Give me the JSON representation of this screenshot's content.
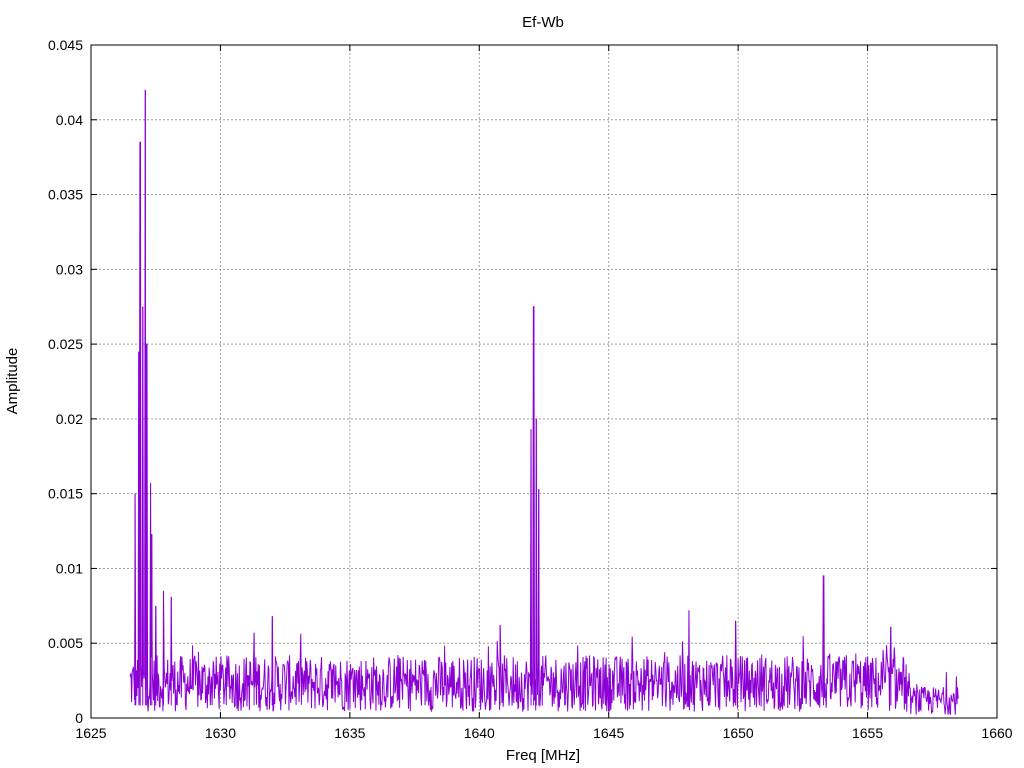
{
  "chart_data": {
    "type": "line",
    "title": "Ef-Wb",
    "xlabel": "Freq [MHz]",
    "ylabel": "Amplitude",
    "xlim": [
      1625,
      1660
    ],
    "ylim": [
      0,
      0.045
    ],
    "xticks": [
      "1625",
      "1630",
      "1635",
      "1640",
      "1645",
      "1650",
      "1655",
      "1660"
    ],
    "yticks": [
      "0",
      "0.005",
      "0.01",
      "0.015",
      "0.02",
      "0.025",
      "0.03",
      "0.035",
      "0.04",
      "0.045"
    ],
    "grid": true,
    "line_color": "#8b00d4",
    "series": [
      {
        "name": "",
        "x_start": 1626.5,
        "x_end": 1658.5,
        "noise_floor": 0.0028,
        "peaks": [
          {
            "x": 1626.7,
            "y": 0.015
          },
          {
            "x": 1626.85,
            "y": 0.0245
          },
          {
            "x": 1626.9,
            "y": 0.0385
          },
          {
            "x": 1627.0,
            "y": 0.0275
          },
          {
            "x": 1627.1,
            "y": 0.042
          },
          {
            "x": 1627.15,
            "y": 0.025
          },
          {
            "x": 1627.3,
            "y": 0.0157
          },
          {
            "x": 1627.35,
            "y": 0.0123
          },
          {
            "x": 1627.5,
            "y": 0.0075
          },
          {
            "x": 1627.8,
            "y": 0.0085
          },
          {
            "x": 1628.1,
            "y": 0.0081
          },
          {
            "x": 1631.3,
            "y": 0.0057
          },
          {
            "x": 1632.0,
            "y": 0.0068
          },
          {
            "x": 1640.8,
            "y": 0.0062
          },
          {
            "x": 1642.0,
            "y": 0.0193
          },
          {
            "x": 1642.1,
            "y": 0.0275
          },
          {
            "x": 1642.2,
            "y": 0.02
          },
          {
            "x": 1642.3,
            "y": 0.0153
          },
          {
            "x": 1648.1,
            "y": 0.0072
          },
          {
            "x": 1649.9,
            "y": 0.0065
          },
          {
            "x": 1653.3,
            "y": 0.0095
          },
          {
            "x": 1655.9,
            "y": 0.0061
          }
        ]
      }
    ]
  }
}
